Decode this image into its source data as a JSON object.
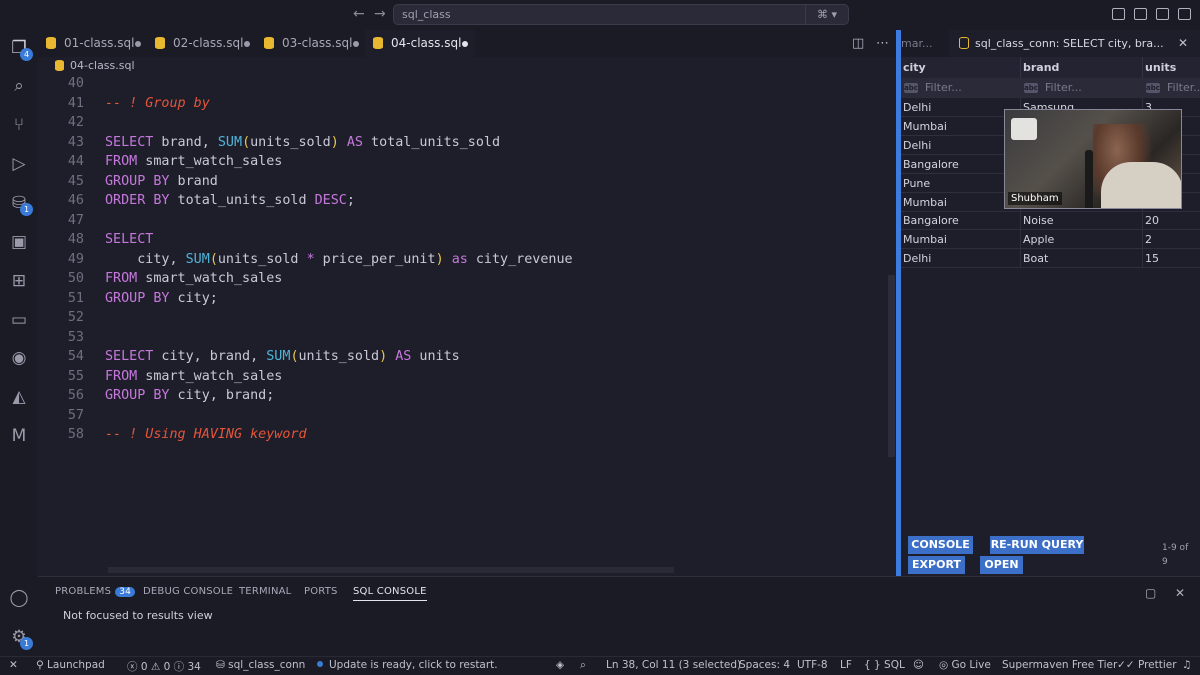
{
  "titlebar": {
    "search_text": "sql_class",
    "back": "←",
    "forward": "→"
  },
  "activity": {
    "explorer_badge": "4",
    "db_badge": "1",
    "settings_badge": "1"
  },
  "tabs": [
    {
      "label": "01-class.sql"
    },
    {
      "label": "02-class.sql"
    },
    {
      "label": "03-class.sql"
    },
    {
      "label": "04-class.sql"
    }
  ],
  "breadcrumb": {
    "file": "04-class.sql"
  },
  "editor": {
    "lines": [
      {
        "n": "40",
        "tokens": []
      },
      {
        "n": "41",
        "tokens": [
          {
            "t": "-- ! Group by",
            "c": "cm"
          }
        ]
      },
      {
        "n": "42",
        "tokens": []
      },
      {
        "n": "43",
        "tokens": [
          {
            "t": "SELECT",
            "c": "kw"
          },
          {
            "t": " brand, "
          },
          {
            "t": "SUM",
            "c": "fn"
          },
          {
            "t": "(",
            "c": "paren"
          },
          {
            "t": "units_sold"
          },
          {
            "t": ")",
            "c": "paren"
          },
          {
            "t": " "
          },
          {
            "t": "AS",
            "c": "kw"
          },
          {
            "t": " total_units_sold"
          }
        ]
      },
      {
        "n": "44",
        "tokens": [
          {
            "t": "FROM",
            "c": "kw"
          },
          {
            "t": " smart_watch_sales"
          }
        ]
      },
      {
        "n": "45",
        "tokens": [
          {
            "t": "GROUP BY",
            "c": "kw"
          },
          {
            "t": " brand"
          }
        ]
      },
      {
        "n": "46",
        "tokens": [
          {
            "t": "ORDER BY",
            "c": "kw"
          },
          {
            "t": " total_units_sold "
          },
          {
            "t": "DESC",
            "c": "kw"
          },
          {
            "t": ";"
          }
        ]
      },
      {
        "n": "47",
        "tokens": []
      },
      {
        "n": "48",
        "tokens": [
          {
            "t": "SELECT",
            "c": "kw"
          }
        ]
      },
      {
        "n": "49",
        "tokens": [
          {
            "t": "    city, "
          },
          {
            "t": "SUM",
            "c": "fn"
          },
          {
            "t": "(",
            "c": "paren"
          },
          {
            "t": "units_sold "
          },
          {
            "t": "*",
            "c": "op"
          },
          {
            "t": " price_per_unit"
          },
          {
            "t": ")",
            "c": "paren"
          },
          {
            "t": " "
          },
          {
            "t": "as",
            "c": "kw"
          },
          {
            "t": " city_revenue"
          }
        ]
      },
      {
        "n": "50",
        "tokens": [
          {
            "t": "FROM",
            "c": "kw"
          },
          {
            "t": " smart_watch_sales"
          }
        ]
      },
      {
        "n": "51",
        "tokens": [
          {
            "t": "GROUP BY",
            "c": "kw"
          },
          {
            "t": " city;"
          }
        ]
      },
      {
        "n": "52",
        "tokens": []
      },
      {
        "n": "53",
        "tokens": []
      },
      {
        "n": "54",
        "tokens": [
          {
            "t": "SELECT",
            "c": "kw"
          },
          {
            "t": " city, brand, "
          },
          {
            "t": "SUM",
            "c": "fn"
          },
          {
            "t": "(",
            "c": "paren"
          },
          {
            "t": "units_sold"
          },
          {
            "t": ")",
            "c": "paren"
          },
          {
            "t": " "
          },
          {
            "t": "AS",
            "c": "kw"
          },
          {
            "t": " units"
          }
        ]
      },
      {
        "n": "55",
        "tokens": [
          {
            "t": "FROM",
            "c": "kw"
          },
          {
            "t": " smart_watch_sales"
          }
        ]
      },
      {
        "n": "56",
        "tokens": [
          {
            "t": "GROUP BY",
            "c": "kw"
          },
          {
            "t": " city, brand;"
          }
        ]
      },
      {
        "n": "57",
        "tokens": []
      },
      {
        "n": "58",
        "tokens": [
          {
            "t": "-- ! Using HAVING keyword",
            "c": "cm"
          }
        ]
      }
    ]
  },
  "results": {
    "prev_tab": "mar...",
    "tab_label": "sql_class_conn: SELECT city, bra...",
    "columns": [
      "city",
      "brand",
      "units"
    ],
    "filter_placeholder": "Filter...",
    "rows": [
      [
        "Delhi",
        "Samsung",
        "3"
      ],
      [
        "Mumbai",
        "",
        ""
      ],
      [
        "Delhi",
        "",
        ""
      ],
      [
        "Bangalore",
        "",
        ""
      ],
      [
        "Pune",
        "",
        ""
      ],
      [
        "Mumbai",
        "",
        ""
      ],
      [
        "Bangalore",
        "Noise",
        "20"
      ],
      [
        "Mumbai",
        "Apple",
        "2"
      ],
      [
        "Delhi",
        "Boat",
        "15"
      ]
    ],
    "buttons": {
      "console": "CONSOLE",
      "rerun": "RE-RUN QUERY",
      "export": "EXPORT",
      "open": "OPEN"
    },
    "rows_info_1": "1-9 of",
    "rows_info_2": "9"
  },
  "webcam": {
    "name": "Shubham"
  },
  "panel": {
    "tabs": [
      "PROBLEMS",
      "DEBUG CONSOLE",
      "TERMINAL",
      "PORTS",
      "SQL CONSOLE"
    ],
    "problems_count": "34",
    "message": "Not focused to results view"
  },
  "status": {
    "launchpad": "Launchpad",
    "errors": "0",
    "warnings": "0",
    "infos": "34",
    "connection": "sql_class_conn",
    "update": "Update is ready, click to restart.",
    "position": "Ln 38, Col 11 (3 selected)",
    "spaces": "Spaces: 4",
    "encoding": "UTF-8",
    "eol": "LF",
    "language": "SQL",
    "golive": "Go Live",
    "supermaven": "Supermaven Free Tier",
    "prettier": "Prettier"
  }
}
